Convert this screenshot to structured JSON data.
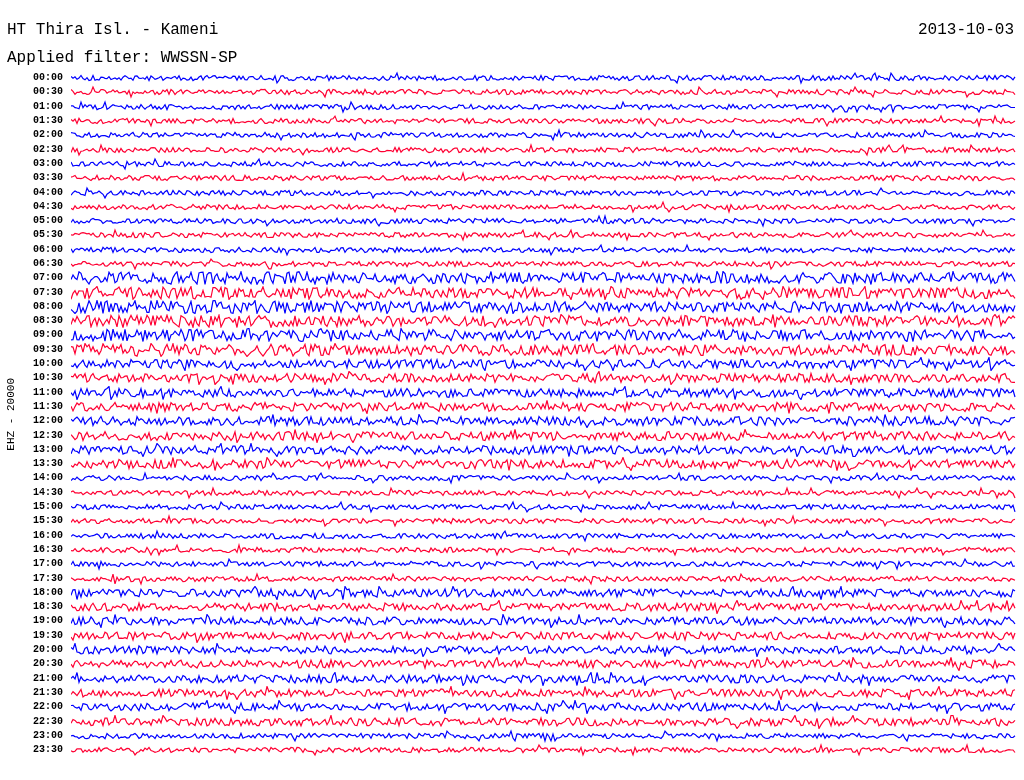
{
  "header": {
    "station": "HT Thira Isl. - Kameni",
    "date": "2013-10-03",
    "filter": "Applied filter: WWSSN-SP"
  },
  "channel": "EHZ - 20000",
  "rows": [
    {
      "time": "00:00",
      "color": "#0000ff"
    },
    {
      "time": "00:30",
      "color": "#ff0033"
    },
    {
      "time": "01:00",
      "color": "#0000ff"
    },
    {
      "time": "01:30",
      "color": "#ff0033"
    },
    {
      "time": "02:00",
      "color": "#0000ff"
    },
    {
      "time": "02:30",
      "color": "#ff0033"
    },
    {
      "time": "03:00",
      "color": "#0000ff"
    },
    {
      "time": "03:30",
      "color": "#ff0033"
    },
    {
      "time": "04:00",
      "color": "#0000ff"
    },
    {
      "time": "04:30",
      "color": "#ff0033"
    },
    {
      "time": "05:00",
      "color": "#0000ff"
    },
    {
      "time": "05:30",
      "color": "#ff0033"
    },
    {
      "time": "06:00",
      "color": "#0000ff"
    },
    {
      "time": "06:30",
      "color": "#ff0033"
    },
    {
      "time": "07:00",
      "color": "#0000ff"
    },
    {
      "time": "07:30",
      "color": "#ff0033"
    },
    {
      "time": "08:00",
      "color": "#0000ff"
    },
    {
      "time": "08:30",
      "color": "#ff0033"
    },
    {
      "time": "09:00",
      "color": "#0000ff"
    },
    {
      "time": "09:30",
      "color": "#ff0033"
    },
    {
      "time": "10:00",
      "color": "#0000ff"
    },
    {
      "time": "10:30",
      "color": "#ff0033"
    },
    {
      "time": "11:00",
      "color": "#0000ff"
    },
    {
      "time": "11:30",
      "color": "#ff0033"
    },
    {
      "time": "12:00",
      "color": "#0000ff"
    },
    {
      "time": "12:30",
      "color": "#ff0033"
    },
    {
      "time": "13:00",
      "color": "#0000ff"
    },
    {
      "time": "13:30",
      "color": "#ff0033"
    },
    {
      "time": "14:00",
      "color": "#0000ff"
    },
    {
      "time": "14:30",
      "color": "#ff0033"
    },
    {
      "time": "15:00",
      "color": "#0000ff"
    },
    {
      "time": "15:30",
      "color": "#ff0033"
    },
    {
      "time": "16:00",
      "color": "#0000ff"
    },
    {
      "time": "16:30",
      "color": "#ff0033"
    },
    {
      "time": "17:00",
      "color": "#0000ff"
    },
    {
      "time": "17:30",
      "color": "#ff0033"
    },
    {
      "time": "18:00",
      "color": "#0000ff"
    },
    {
      "time": "18:30",
      "color": "#ff0033"
    },
    {
      "time": "19:00",
      "color": "#0000ff"
    },
    {
      "time": "19:30",
      "color": "#ff0033"
    },
    {
      "time": "20:00",
      "color": "#0000ff"
    },
    {
      "time": "20:30",
      "color": "#ff0033"
    },
    {
      "time": "21:00",
      "color": "#0000ff"
    },
    {
      "time": "21:30",
      "color": "#ff0033"
    },
    {
      "time": "22:00",
      "color": "#0000ff"
    },
    {
      "time": "22:30",
      "color": "#ff0033"
    },
    {
      "time": "23:00",
      "color": "#0000ff"
    },
    {
      "time": "23:30",
      "color": "#ff0033"
    }
  ]
}
